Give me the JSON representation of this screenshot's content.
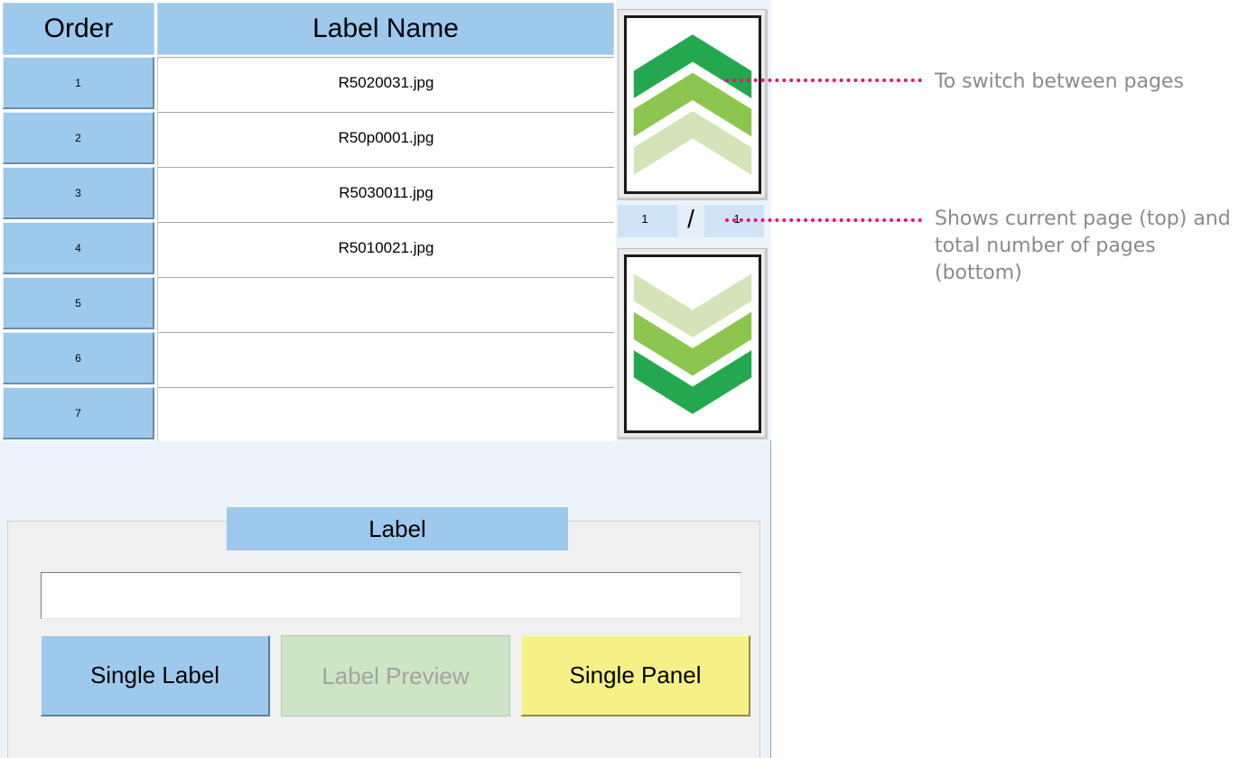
{
  "table": {
    "col_order": "Order",
    "col_name": "Label Name",
    "rows": [
      {
        "order": "1",
        "name": "R5020031.jpg"
      },
      {
        "order": "2",
        "name": "R50p0001.jpg"
      },
      {
        "order": "3",
        "name": "R5030011.jpg"
      },
      {
        "order": "4",
        "name": "R5010021.jpg"
      },
      {
        "order": "5",
        "name": ""
      },
      {
        "order": "6",
        "name": ""
      },
      {
        "order": "7",
        "name": ""
      }
    ]
  },
  "pager": {
    "current": "1",
    "separator": "/",
    "total": "1",
    "up_icon": "chevron-up-icon",
    "down_icon": "chevron-down-icon",
    "colors": {
      "dark": "#23a84f",
      "mid": "#8dc64f",
      "light": "#d3e4b8"
    }
  },
  "label": {
    "title": "Label",
    "input_value": "",
    "btn_single_label": "Single Label",
    "btn_label_preview": "Label Preview",
    "btn_single_panel": "Single Panel"
  },
  "annotations": {
    "page_switch": "To switch between pages",
    "page_count": "Shows current page (top) and total number of pages (bottom)",
    "color": "#e3127a"
  }
}
